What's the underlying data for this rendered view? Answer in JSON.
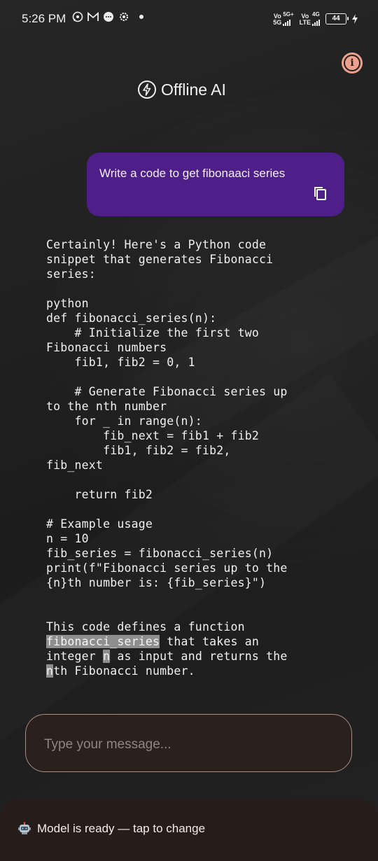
{
  "status_bar": {
    "time": "5:26 PM",
    "net1": {
      "top": "Vo",
      "bottom": "5G",
      "type": "5G+"
    },
    "net2": {
      "top": "Vo",
      "bottom": "LTE",
      "type": "4G"
    },
    "battery": "44"
  },
  "header": {
    "title": "Offline AI"
  },
  "user_message": {
    "text": "Write a code to get fibonaaci series"
  },
  "assistant_message": {
    "intro": "Certainly! Here's a Python code\nsnippet that generates Fibonacci\nseries:",
    "code": "python\ndef fibonacci_series(n):\n    # Initialize the first two\nFibonacci numbers\n    fib1, fib2 = 0, 1\n\n    # Generate Fibonacci series up\nto the nth number\n    for _ in range(n):\n        fib_next = fib1 + fib2\n        fib1, fib2 = fib2,\nfib_next\n\n    return fib2\n\n# Example usage\nn = 10\nfib_series = fibonacci_series(n)\nprint(f\"Fibonacci series up to the\n{n}th number is: {fib_series}\")",
    "outro_line1": "This code defines a function",
    "outro_hl1": "fibonacci_series",
    "outro_line2_rest": " that takes an",
    "outro_line3_pre": "integer ",
    "outro_hl2": "n",
    "outro_line3_rest": " as input and returns the",
    "outro_hl3": "n",
    "outro_line4_rest": "th Fibonacci number."
  },
  "input": {
    "placeholder": "Type your message..."
  },
  "model_bar": {
    "label": "Model is ready — tap to change"
  },
  "colors": {
    "bubble": "#4e1f88",
    "info": "#eaa18d",
    "input_border": "#a48f86"
  }
}
